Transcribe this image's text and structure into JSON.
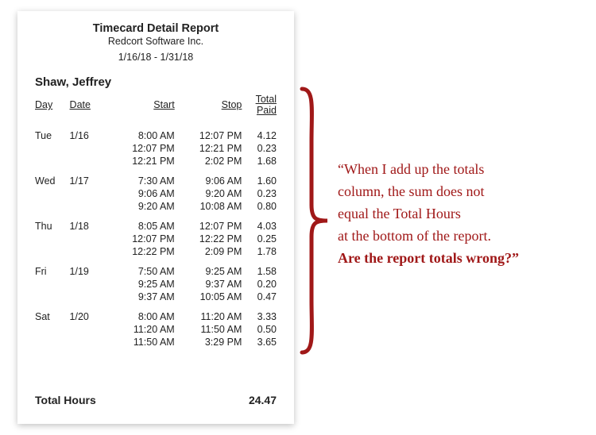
{
  "report": {
    "title": "Timecard Detail Report",
    "company": "Redcort Software Inc.",
    "date_range": "1/16/18 - 1/31/18",
    "employee": "Shaw, Jeffrey",
    "columns": {
      "day": "Day",
      "date": "Date",
      "start": "Start",
      "stop": "Stop",
      "total_paid": "Total Paid"
    },
    "rows": [
      {
        "day": "Tue",
        "date": "1/16",
        "start": "8:00 AM",
        "stop": "12:07 PM",
        "total": "4.12",
        "first": true
      },
      {
        "day": "",
        "date": "",
        "start": "12:07 PM",
        "stop": "12:21 PM",
        "total": "0.23"
      },
      {
        "day": "",
        "date": "",
        "start": "12:21 PM",
        "stop": "2:02 PM",
        "total": "1.68"
      },
      {
        "day": "Wed",
        "date": "1/17",
        "start": "7:30 AM",
        "stop": "9:06 AM",
        "total": "1.60",
        "first": true
      },
      {
        "day": "",
        "date": "",
        "start": "9:06 AM",
        "stop": "9:20 AM",
        "total": "0.23"
      },
      {
        "day": "",
        "date": "",
        "start": "9:20 AM",
        "stop": "10:08 AM",
        "total": "0.80"
      },
      {
        "day": "Thu",
        "date": "1/18",
        "start": "8:05 AM",
        "stop": "12:07 PM",
        "total": "4.03",
        "first": true
      },
      {
        "day": "",
        "date": "",
        "start": "12:07 PM",
        "stop": "12:22 PM",
        "total": "0.25"
      },
      {
        "day": "",
        "date": "",
        "start": "12:22 PM",
        "stop": "2:09 PM",
        "total": "1.78"
      },
      {
        "day": "Fri",
        "date": "1/19",
        "start": "7:50 AM",
        "stop": "9:25 AM",
        "total": "1.58",
        "first": true
      },
      {
        "day": "",
        "date": "",
        "start": "9:25 AM",
        "stop": "9:37 AM",
        "total": "0.20"
      },
      {
        "day": "",
        "date": "",
        "start": "9:37 AM",
        "stop": "10:05 AM",
        "total": "0.47"
      },
      {
        "day": "Sat",
        "date": "1/20",
        "start": "8:00 AM",
        "stop": "11:20 AM",
        "total": "3.33",
        "first": true
      },
      {
        "day": "",
        "date": "",
        "start": "11:20 AM",
        "stop": "11:50 AM",
        "total": "0.50"
      },
      {
        "day": "",
        "date": "",
        "start": "11:50 AM",
        "stop": "3:29 PM",
        "total": "3.65"
      }
    ],
    "total_hours_label": "Total Hours",
    "total_hours_value": "24.47"
  },
  "annotation": {
    "line1": "“When I add up the totals",
    "line2": "column, the sum does not",
    "line3": "equal the Total Hours",
    "line4": "at the bottom of the report.",
    "line5": "Are the report totals wrong?”"
  },
  "colors": {
    "annotation": "#a01818"
  }
}
